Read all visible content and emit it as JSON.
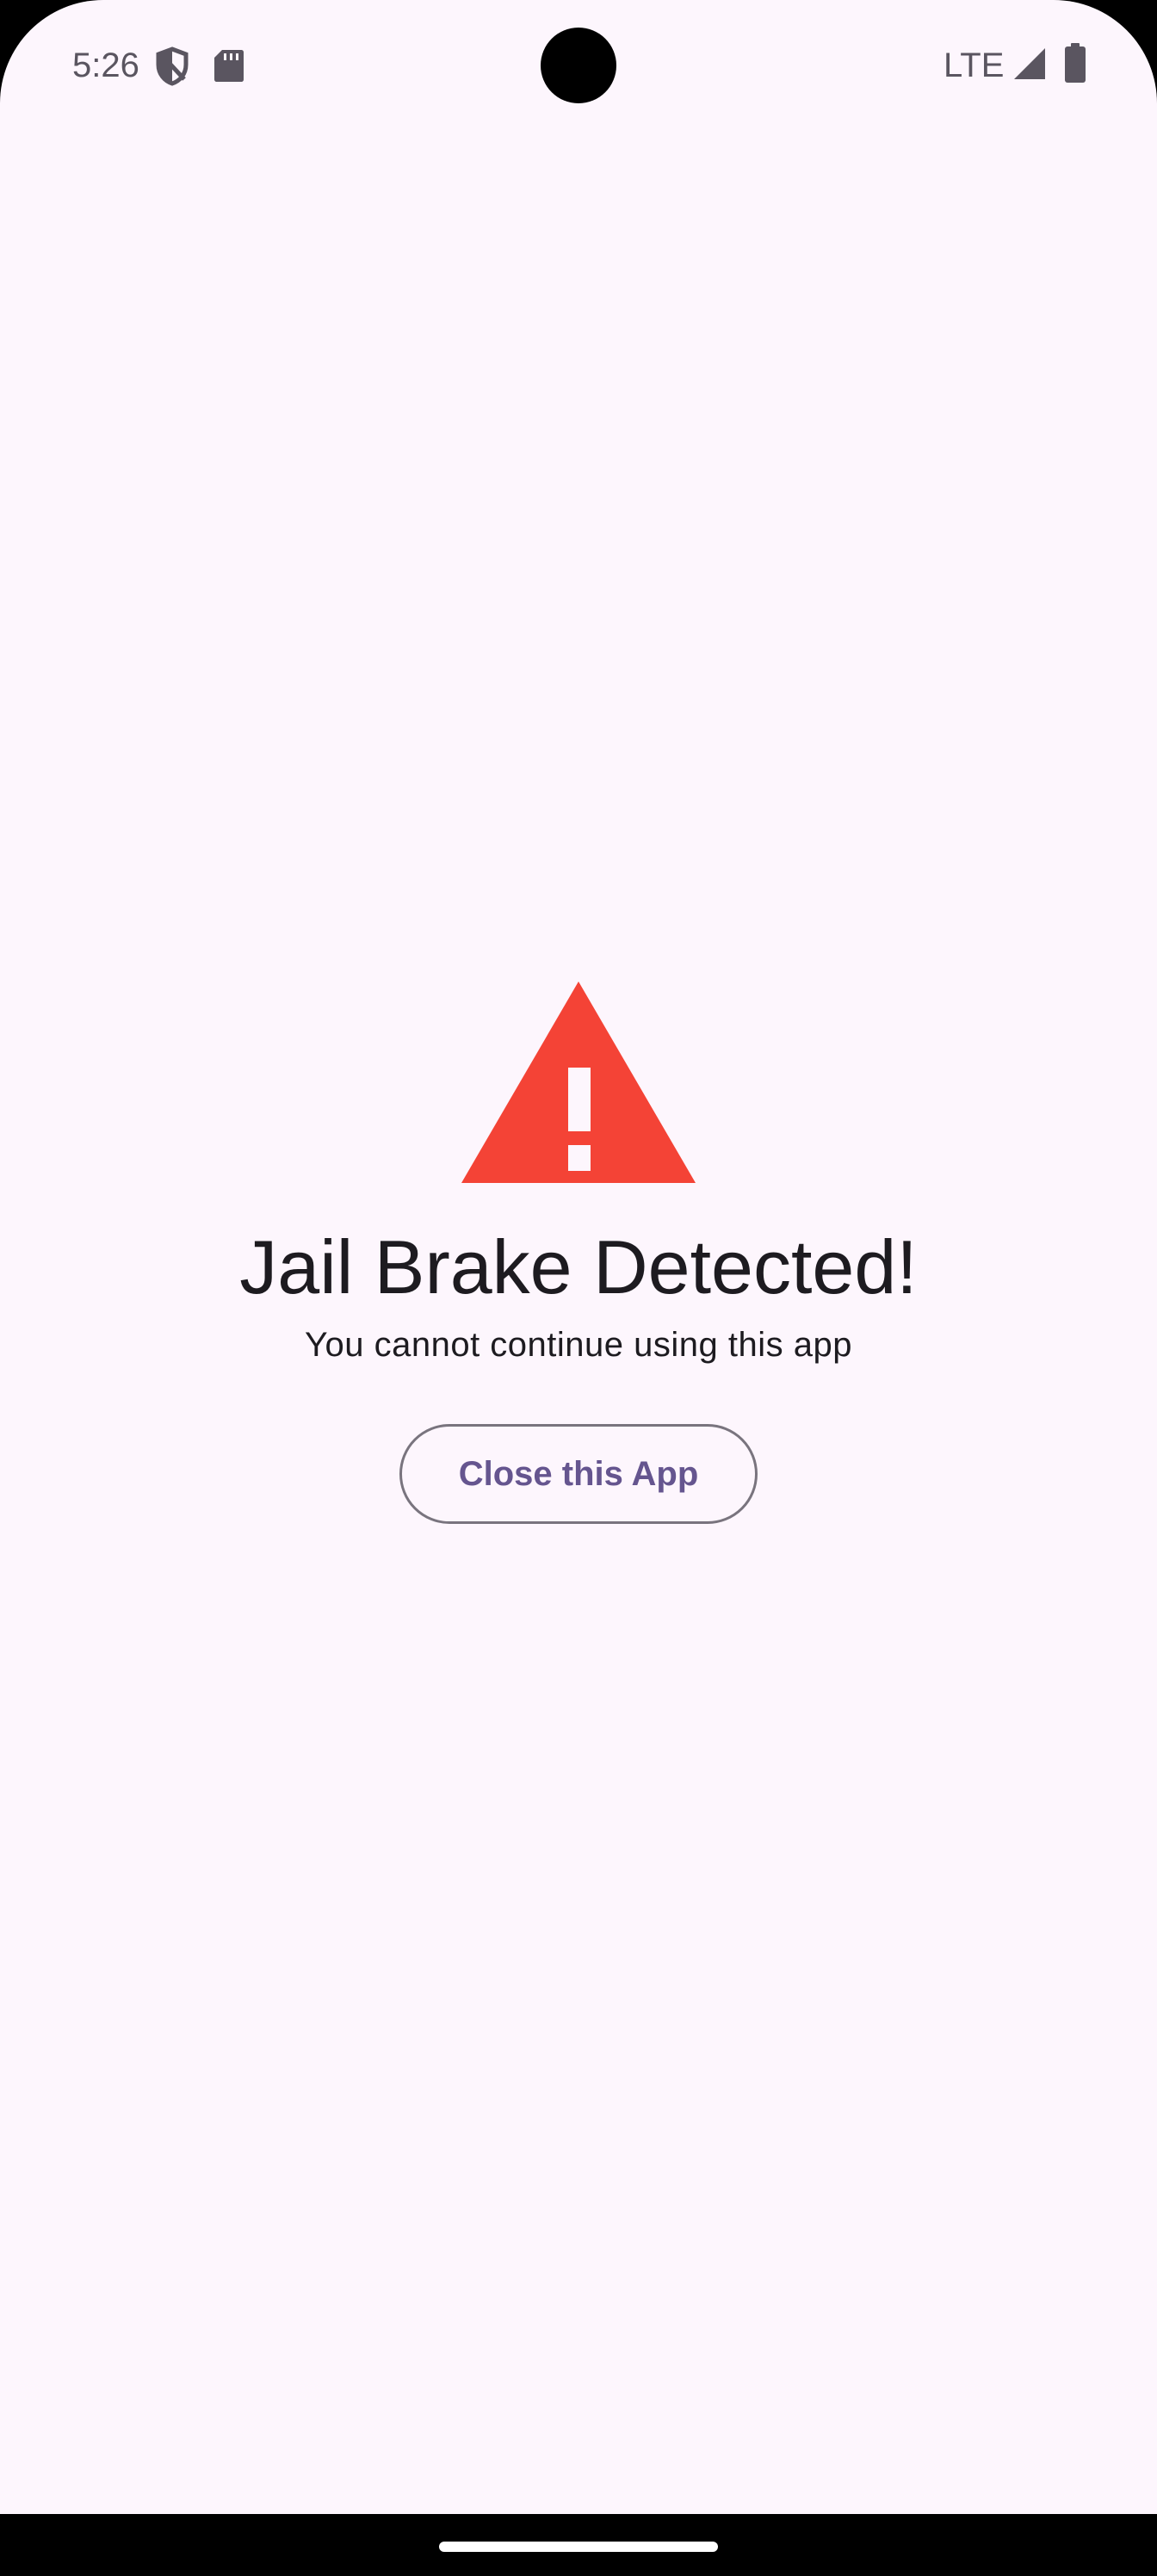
{
  "status_bar": {
    "time": "5:26",
    "network": "LTE",
    "icons": [
      "vpn-shield-icon",
      "sd-card-icon",
      "signal-icon",
      "battery-icon"
    ]
  },
  "alert": {
    "icon": "warning-icon",
    "icon_color": "#f44336",
    "title": "Jail Brake Detected!",
    "message": "You cannot continue using this app",
    "button_label": "Close this App"
  },
  "colors": {
    "background": "#fdf6fd",
    "button_text": "#65558f",
    "button_border": "#79747e",
    "text": "#1d1b20"
  }
}
